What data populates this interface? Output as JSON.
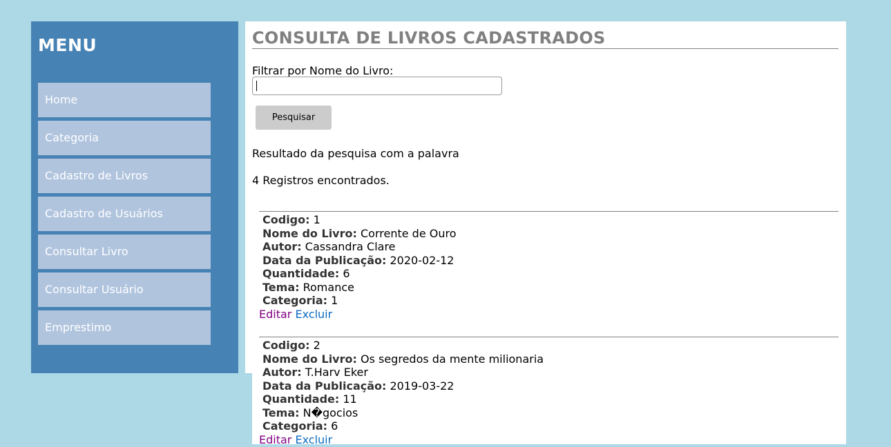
{
  "menu": {
    "title": "MENU",
    "items": [
      {
        "label": "Home"
      },
      {
        "label": "Categoria"
      },
      {
        "label": "Cadastro de Livros"
      },
      {
        "label": "Cadastro de Usuários"
      },
      {
        "label": "Consultar Livro"
      },
      {
        "label": "Consultar Usuário"
      },
      {
        "label": "Emprestimo"
      }
    ]
  },
  "page": {
    "title": "CONSULTA DE LIVROS CADASTRADOS",
    "filter_label": "Filtrar por Nome do Livro:",
    "filter_value": "",
    "search_button": "Pesquisar",
    "result_text": "Resultado da pesquisa com a palavra",
    "count_text": "4 Registros encontrados."
  },
  "field_labels": {
    "code": "Codigo:",
    "name": "Nome do Livro:",
    "author": "Autor:",
    "date": "Data da Publicação:",
    "qty": "Quantidade:",
    "theme": "Tema:",
    "category": "Categoria:"
  },
  "actions": {
    "edit": "Editar",
    "delete": "Excluir"
  },
  "records": [
    {
      "code": "1",
      "name": "Corrente de Ouro",
      "author": "Cassandra Clare",
      "date": "2020-02-12",
      "qty": "6",
      "theme": "Romance",
      "category": "1"
    },
    {
      "code": "2",
      "name": "Os segredos da mente milionaria",
      "author": "T.Harv Eker",
      "date": "2019-03-22",
      "qty": "11",
      "theme": "N�gocios",
      "category": "6"
    }
  ],
  "colors": {
    "background": "#add8e6",
    "sidebar": "#4682b4",
    "menu_item": "#b0c4de",
    "title": "#808080",
    "edit_link": "#800080",
    "delete_link": "#0b6bbf"
  }
}
